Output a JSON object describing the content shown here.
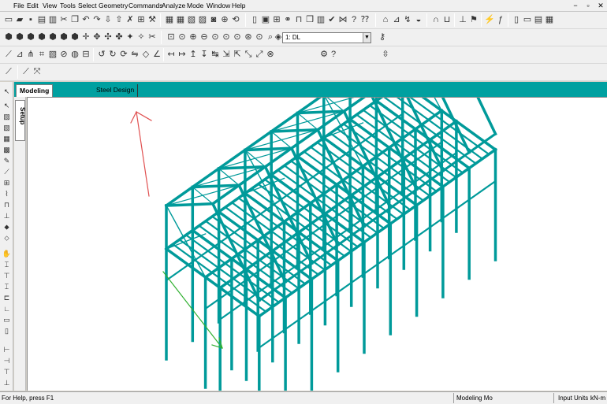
{
  "menu": {
    "items": [
      "File",
      "Edit",
      "View",
      "Tools",
      "Select",
      "Geometry",
      "Commands",
      "Analyze",
      "Mode",
      "Window",
      "Help"
    ]
  },
  "window_controls": [
    "−",
    "▫",
    "✕"
  ],
  "toolbar": {
    "load_case_selected": "1: DL"
  },
  "tabs": {
    "modeling": "Modeling",
    "steel_design": "Steel Design"
  },
  "side_tab": {
    "setup": "Setup"
  },
  "status": {
    "help": "For Help, press F1",
    "mode": "Modeling Mo",
    "units_label": "Input Units :",
    "units_value": "kN-m"
  },
  "colors": {
    "structure": "#009a9a",
    "tab_bar": "#00a0a0",
    "axis_y": "#e05050",
    "axis_z": "#30b030"
  }
}
